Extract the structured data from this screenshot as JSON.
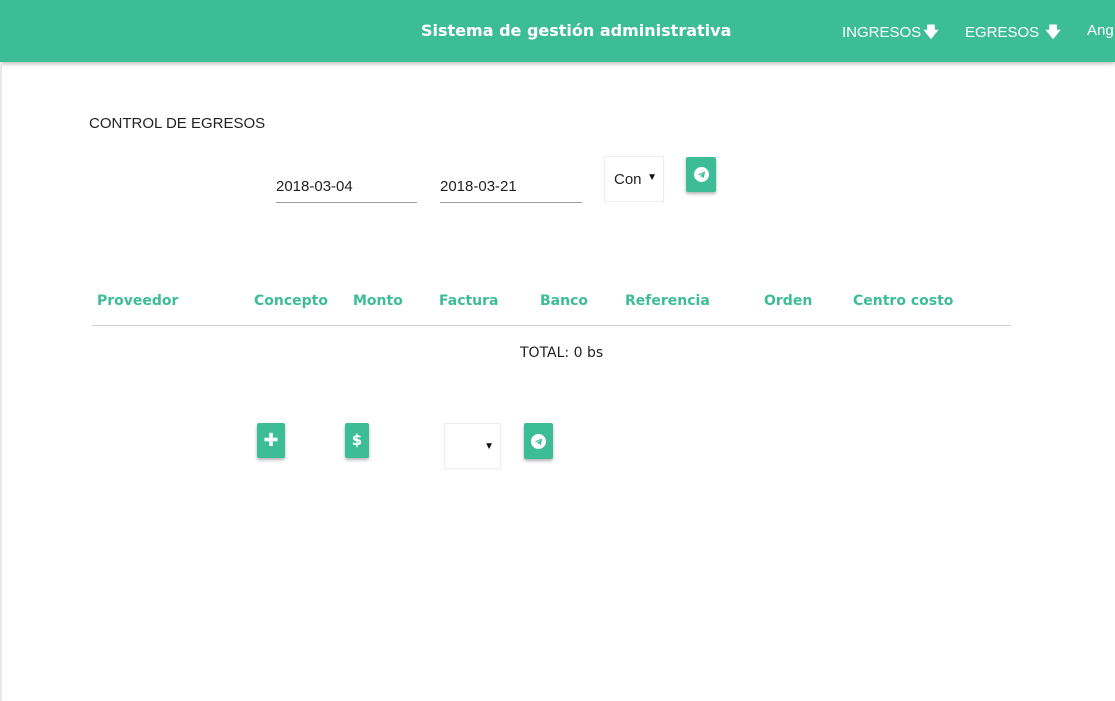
{
  "header": {
    "title": "Sistema de gestión administrativa",
    "nav": [
      {
        "label": "INGRESOS",
        "icon": "arrow-down-icon"
      },
      {
        "label": "EGRESOS",
        "icon": "arrow-down-icon"
      },
      {
        "label": "Ang"
      }
    ],
    "color": "#3dbd96"
  },
  "page": {
    "title": "CONTROL DE EGRESOS"
  },
  "filter": {
    "date_from": "2018-03-04",
    "date_to": "2018-03-21",
    "select_value": "Con",
    "submit_icon": "telegram-icon"
  },
  "table": {
    "headers": [
      "Proveedor",
      "Concepto",
      "Monto",
      "Factura",
      "Banco",
      "Referencia",
      "Orden",
      "Centro costo"
    ],
    "rows": []
  },
  "total": "TOTAL: 0 bs",
  "actions": {
    "add_icon": "plus-icon",
    "pay_icon": "dollar-icon",
    "select_value": "",
    "submit_icon": "telegram-icon"
  }
}
